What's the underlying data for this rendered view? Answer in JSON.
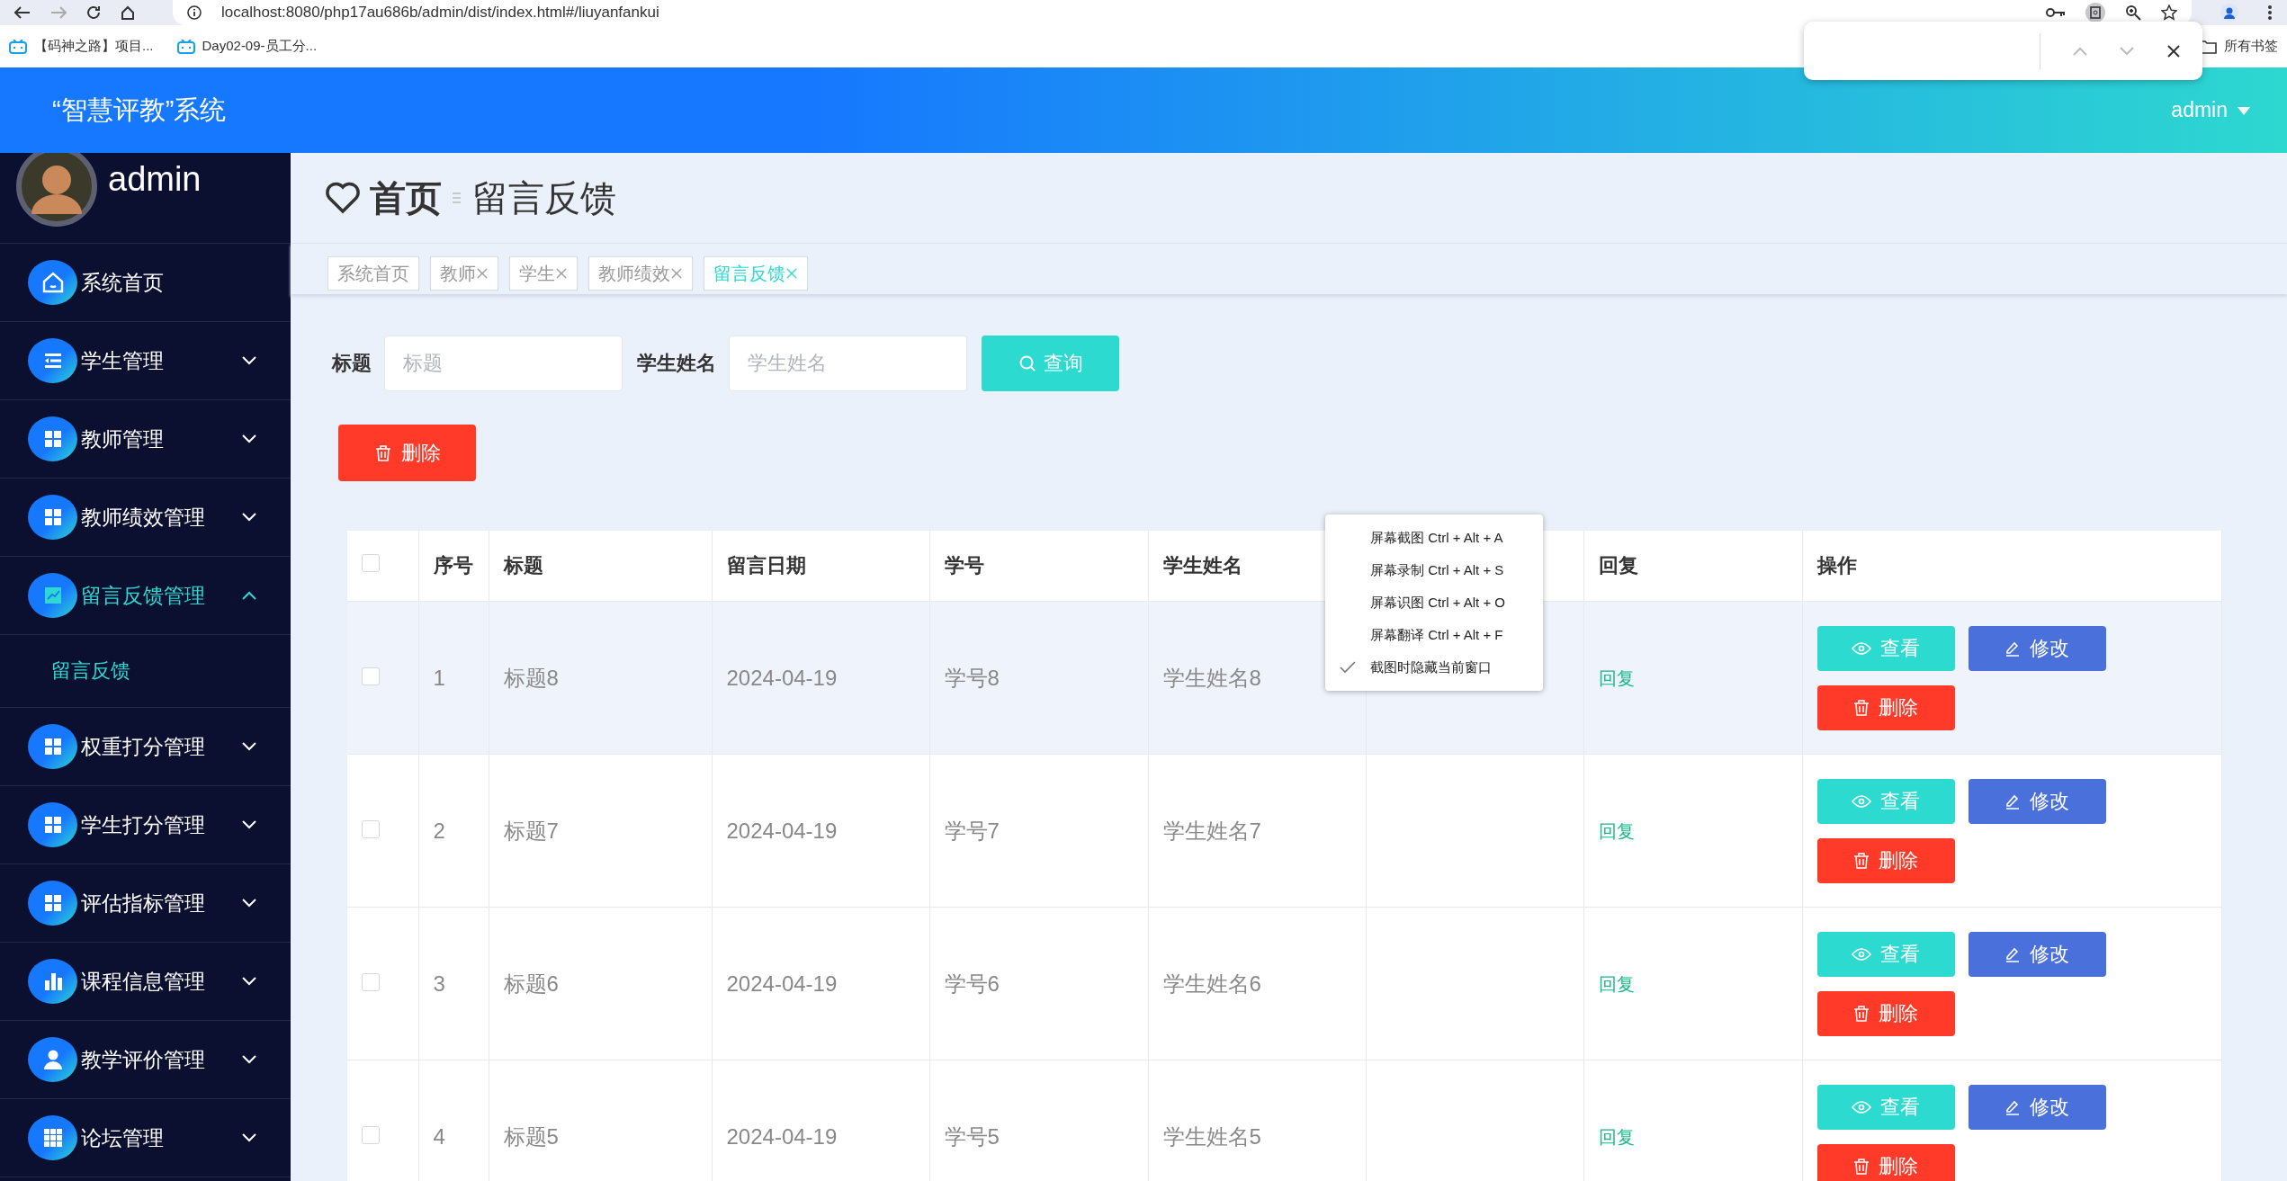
{
  "browser": {
    "url": "localhost:8080/php17au686b/admin/dist/index.html#/liuyanfankui",
    "bookmarks": [
      "【码神之路】项目...",
      "Day02-09-员工分..."
    ],
    "all_bookmarks": "所有书签"
  },
  "header": {
    "title": "“智慧评教”系统",
    "user": "admin"
  },
  "sidebar": {
    "user_name": "admin",
    "items": [
      {
        "label": "系统首页",
        "kind": "home",
        "selected": false
      },
      {
        "label": "学生管理",
        "kind": "list",
        "expanded": false,
        "selected": false
      },
      {
        "label": "教师管理",
        "kind": "grid",
        "expanded": false,
        "selected": false
      },
      {
        "label": "教师绩效管理",
        "kind": "grid",
        "expanded": false,
        "selected": false
      },
      {
        "label": "留言反馈管理",
        "kind": "chart",
        "expanded": true,
        "selected": true,
        "children": [
          {
            "label": "留言反馈",
            "selected": true
          }
        ]
      },
      {
        "label": "权重打分管理",
        "kind": "grid",
        "expanded": false,
        "selected": false
      },
      {
        "label": "学生打分管理",
        "kind": "grid",
        "expanded": false,
        "selected": false
      },
      {
        "label": "评估指标管理",
        "kind": "grid",
        "expanded": false,
        "selected": false
      },
      {
        "label": "课程信息管理",
        "kind": "bars",
        "expanded": false,
        "selected": false
      },
      {
        "label": "教学评价管理",
        "kind": "user",
        "expanded": false,
        "selected": false
      },
      {
        "label": "论坛管理",
        "kind": "apps",
        "expanded": false,
        "selected": false
      }
    ]
  },
  "breadcrumb": {
    "home": "首页",
    "current": "留言反馈"
  },
  "tags": [
    {
      "label": "系统首页",
      "closable": false,
      "selected": false
    },
    {
      "label": "教师",
      "closable": true,
      "selected": false
    },
    {
      "label": "学生",
      "closable": true,
      "selected": false
    },
    {
      "label": "教师绩效",
      "closable": true,
      "selected": false
    },
    {
      "label": "留言反馈",
      "closable": true,
      "selected": true
    }
  ],
  "search": {
    "fields": [
      {
        "label": "标题",
        "placeholder": "标题"
      },
      {
        "label": "学生姓名",
        "placeholder": "学生姓名"
      }
    ],
    "button": "查询"
  },
  "delete_button": "删除",
  "table": {
    "select_all": {
      "checked": false
    },
    "columns": [
      {
        "label": "序号"
      },
      {
        "label": "标题"
      },
      {
        "label": "留言日期"
      },
      {
        "label": "学号"
      },
      {
        "label": "学生姓名"
      },
      {
        "label": "回复"
      },
      {
        "label": "操作"
      }
    ],
    "rows": [
      {
        "checked": false,
        "highlighted": true,
        "no": "1",
        "title": "标题8",
        "date": "2024-04-19",
        "student_no": "学号8",
        "student_name": "学生姓名8",
        "reply": "回复",
        "actions": [
          {
            "kind": "view",
            "label": "查看"
          },
          {
            "kind": "edit",
            "label": "修改"
          },
          {
            "kind": "delete",
            "label": "删除"
          }
        ]
      },
      {
        "checked": false,
        "highlighted": false,
        "no": "2",
        "title": "标题7",
        "date": "2024-04-19",
        "student_no": "学号7",
        "student_name": "学生姓名7",
        "reply": "回复",
        "actions": [
          {
            "kind": "view",
            "label": "查看"
          },
          {
            "kind": "edit",
            "label": "修改"
          },
          {
            "kind": "delete",
            "label": "删除"
          }
        ]
      },
      {
        "checked": false,
        "highlighted": false,
        "no": "3",
        "title": "标题6",
        "date": "2024-04-19",
        "student_no": "学号6",
        "student_name": "学生姓名6",
        "reply": "回复",
        "actions": [
          {
            "kind": "view",
            "label": "查看"
          },
          {
            "kind": "edit",
            "label": "修改"
          },
          {
            "kind": "delete",
            "label": "删除"
          }
        ]
      },
      {
        "checked": false,
        "highlighted": false,
        "no": "4",
        "title": "标题5",
        "date": "2024-04-19",
        "student_no": "学号5",
        "student_name": "学生姓名5",
        "reply": "回复",
        "actions": [
          {
            "kind": "view",
            "label": "查看"
          },
          {
            "kind": "edit",
            "label": "修改"
          },
          {
            "kind": "delete",
            "label": "删除"
          }
        ]
      }
    ]
  },
  "context_menu": [
    {
      "label": "屏幕截图 Ctrl + Alt + A",
      "checked": false
    },
    {
      "label": "屏幕录制 Ctrl + Alt + S",
      "checked": false
    },
    {
      "label": "屏幕识图 Ctrl + Alt + O",
      "checked": false
    },
    {
      "label": "屏幕翻译 Ctrl + Alt + F",
      "checked": false
    },
    {
      "label": "截图时隐藏当前窗口",
      "checked": true
    }
  ]
}
